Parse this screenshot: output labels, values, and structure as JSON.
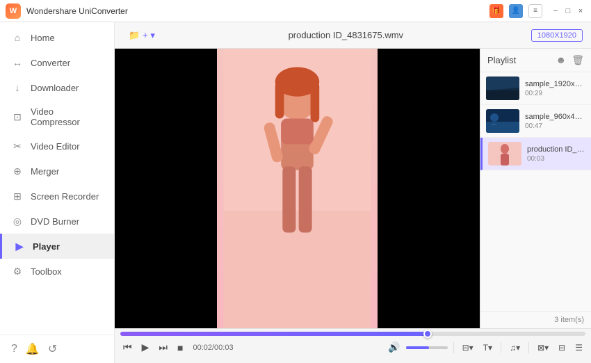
{
  "app": {
    "title": "Wondershare UniConverter",
    "logo_text": "W"
  },
  "titlebar": {
    "icons": [
      {
        "name": "gift-icon",
        "symbol": "🎁",
        "color": "#ff6b35"
      },
      {
        "name": "user-icon",
        "symbol": "👤",
        "color": "#4a90d9"
      },
      {
        "name": "menu-icon",
        "symbol": "≡",
        "color": "outline"
      }
    ],
    "controls": [
      "−",
      "□",
      "×"
    ]
  },
  "sidebar": {
    "items": [
      {
        "id": "home",
        "label": "Home",
        "icon": "⌂",
        "active": false
      },
      {
        "id": "converter",
        "label": "Converter",
        "icon": "↔",
        "active": false
      },
      {
        "id": "downloader",
        "label": "Downloader",
        "icon": "↓",
        "active": false
      },
      {
        "id": "video-compressor",
        "label": "Video Compressor",
        "icon": "⊡",
        "active": false
      },
      {
        "id": "video-editor",
        "label": "Video Editor",
        "icon": "✂",
        "active": false
      },
      {
        "id": "merger",
        "label": "Merger",
        "icon": "⊕",
        "active": false
      },
      {
        "id": "screen-recorder",
        "label": "Screen Recorder",
        "icon": "⊞",
        "active": false
      },
      {
        "id": "dvd-burner",
        "label": "DVD Burner",
        "icon": "◎",
        "active": false
      },
      {
        "id": "player",
        "label": "Player",
        "icon": "▶",
        "active": true
      },
      {
        "id": "toolbox",
        "label": "Toolbox",
        "icon": "⚙",
        "active": false
      }
    ],
    "footer": {
      "icons": [
        "?",
        "🔔",
        "↺"
      ]
    }
  },
  "topbar": {
    "add_button": "+ ▾",
    "filename": "production ID_4831675.wmv",
    "resolution": "1080X1920"
  },
  "playlist": {
    "title": "Playlist",
    "items": [
      {
        "name": "sample_1920x10...",
        "duration": "00:29",
        "type": "landscape",
        "active": false
      },
      {
        "name": "sample_960x400...",
        "duration": "00:47",
        "type": "ocean",
        "active": false
      },
      {
        "name": "production ID_4...",
        "duration": "00:03",
        "type": "portrait",
        "active": true
      }
    ],
    "item_count": "3 item(s)"
  },
  "player": {
    "current_time": "00:02",
    "total_time": "00:03",
    "time_display": "00:02/00:03",
    "progress_percent": 66
  },
  "controls": {
    "prev": "⏮",
    "play": "▶",
    "next": "⏭",
    "stop": "■",
    "volume_icon": "🔊",
    "captions": "⊟",
    "text": "T",
    "audio": "♫",
    "screenshot": "⊠",
    "fullscreen": "⊟",
    "more": "☰"
  }
}
